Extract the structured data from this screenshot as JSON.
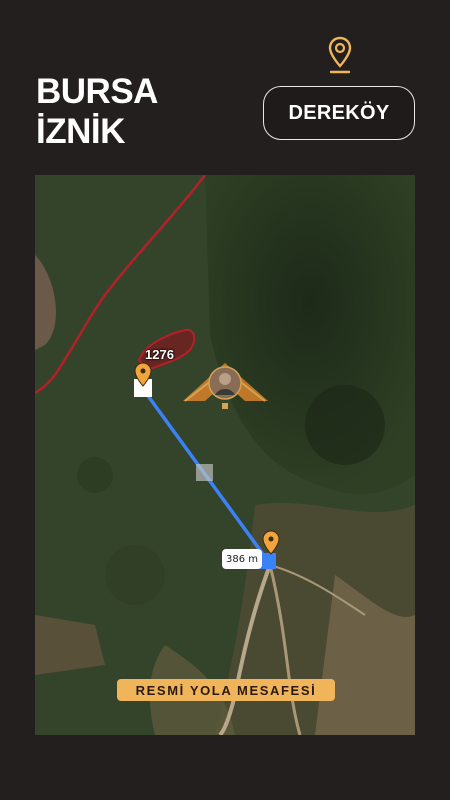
{
  "header": {
    "city_line1": "BURSA",
    "city_line2": "İZNİK",
    "village_button": "DEREKÖY"
  },
  "map": {
    "parcel_number": "1276",
    "distance_label": "386 m"
  },
  "footer": {
    "banner_text": "RESMİ YOLA MESAFESİ"
  },
  "icons": {
    "location_pin": "map-pin-icon",
    "logo": "agent-logo-icon"
  },
  "colors": {
    "accent": "#f0b45b",
    "parcel_border": "#b3202a",
    "measure_line": "#3b82f6",
    "background": "#231f1e"
  }
}
